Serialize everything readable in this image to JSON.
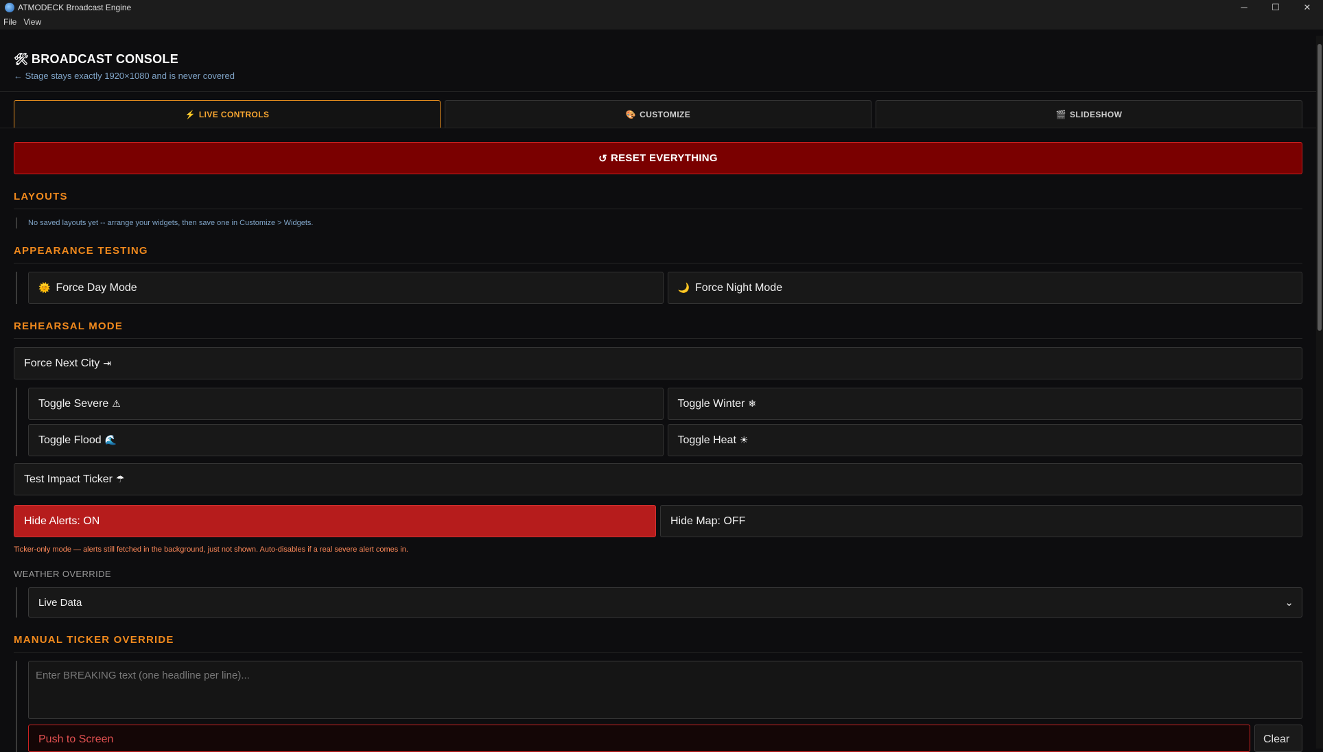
{
  "window": {
    "title": "ATMODECK Broadcast Engine",
    "minimize": "─",
    "maximize": "☐",
    "close": "✕"
  },
  "menu": [
    "File",
    "View"
  ],
  "console": {
    "icon": "🛠",
    "title": "BROADCAST CONSOLE",
    "subtitle": "← Stage stays exactly 1920×1080 and is never covered"
  },
  "tabs": [
    {
      "icon": "⚡",
      "label": "LIVE CONTROLS",
      "active": true
    },
    {
      "icon": "🎨",
      "label": "CUSTOMIZE",
      "active": false
    },
    {
      "icon": "🎬",
      "label": "SLIDESHOW",
      "active": false
    }
  ],
  "reset": {
    "icon": "↺",
    "label": "RESET EVERYTHING"
  },
  "layouts": {
    "heading": "LAYOUTS",
    "note": "No saved layouts yet -- arrange your widgets, then save one in Customize > Widgets."
  },
  "appearance": {
    "heading": "APPEARANCE TESTING",
    "day": {
      "icon": "🌞",
      "label": "Force Day Mode"
    },
    "night": {
      "icon": "🌙",
      "label": "Force Night Mode"
    }
  },
  "rehearsal": {
    "heading": "REHEARSAL MODE",
    "next_city": {
      "label": "Force Next City",
      "icon": "⇥"
    },
    "severe": {
      "label": "Toggle Severe",
      "icon": "⚠"
    },
    "winter": {
      "label": "Toggle Winter",
      "icon": "❄"
    },
    "flood": {
      "label": "Toggle Flood",
      "icon": "🌊"
    },
    "heat": {
      "label": "Toggle Heat",
      "icon": "☀"
    },
    "ticker": {
      "label": "Test Impact Ticker",
      "icon": "☂"
    },
    "hide_alerts": "Hide Alerts: ON",
    "hide_map": "Hide Map: OFF",
    "hint": "Ticker-only mode — alerts still fetched in the background, just not shown. Auto-disables if a real severe alert comes in."
  },
  "weather_override": {
    "label": "WEATHER OVERRIDE",
    "selected": "Live Data",
    "chevron": "⌄"
  },
  "manual_ticker": {
    "heading": "MANUAL TICKER OVERRIDE",
    "placeholder": "Enter BREAKING text (one headline per line)...",
    "push": "Push to Screen",
    "clear": "Clear"
  }
}
